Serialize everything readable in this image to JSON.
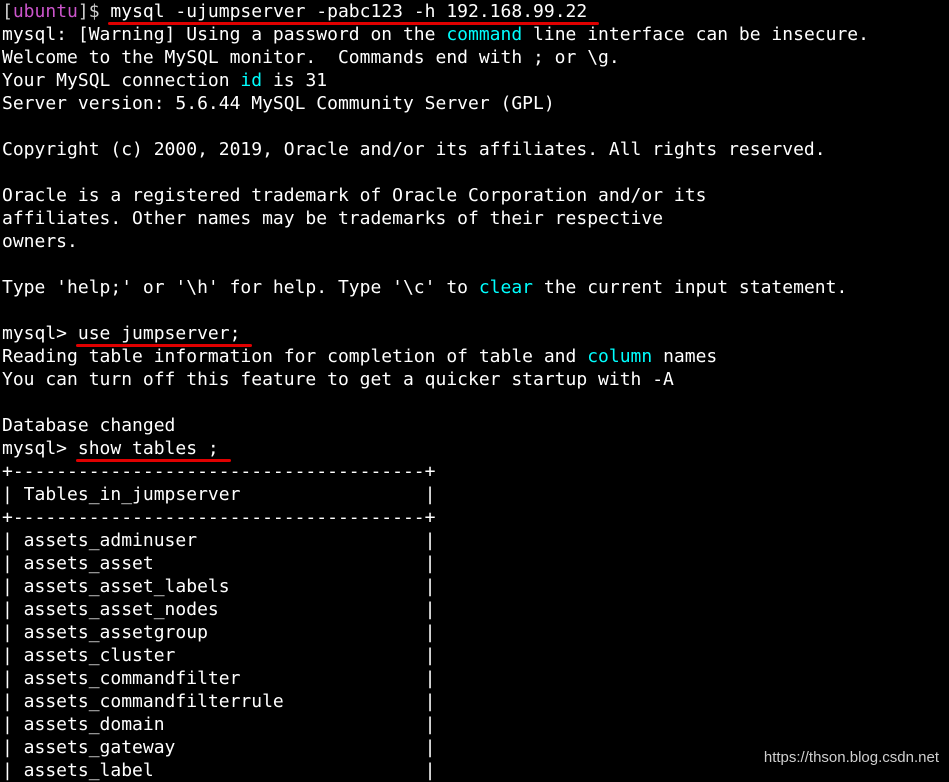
{
  "colors": {
    "background": "#000000",
    "text": "#ffffff",
    "keyword": "#00ffff",
    "prompt_user": "#cc55cc",
    "underline": "#e00000"
  },
  "terminal": {
    "shell_prompt": {
      "open": "[",
      "user": "ubuntu",
      "close": "]$ ",
      "command": "mysql -ujumpserver -pabc123 -h 192.168.99.22"
    },
    "warning": {
      "pre": "mysql: [Warning] Using a password on the ",
      "kw": "command",
      "post": " line interface can be insecure."
    },
    "welcome": "Welcome to the MySQL monitor.  Commands end with ; or \\g.",
    "connection": {
      "pre": "Your MySQL connection ",
      "kw": "id",
      "post": " is 31"
    },
    "server_version": "Server version: 5.6.44 MySQL Community Server (GPL)",
    "copyright": "Copyright (c) 2000, 2019, Oracle and/or its affiliates. All rights reserved.",
    "trademark_1": "Oracle is a registered trademark of Oracle Corporation and/or its",
    "trademark_2": "affiliates. Other names may be trademarks of their respective",
    "trademark_3": "owners.",
    "help": {
      "pre": "Type 'help;' or '\\h' for help. Type '\\c' to ",
      "kw": "clear",
      "post": " the current input statement."
    },
    "mysql_prompt": "mysql> ",
    "use_command": "use jumpserver;",
    "reading": {
      "pre": "Reading table information for completion of table and ",
      "kw": "column",
      "post": " names"
    },
    "quicker": "You can turn off this feature to get a quicker startup with -A",
    "db_changed": "Database changed",
    "show_command": "show tables ;",
    "table_border": "+--------------------------------------+",
    "table_header": "| Tables_in_jumpserver                 |",
    "rows": [
      "| assets_adminuser                     |",
      "| assets_asset                         |",
      "| assets_asset_labels                  |",
      "| assets_asset_nodes                   |",
      "| assets_assetgroup                    |",
      "| assets_cluster                       |",
      "| assets_commandfilter                 |",
      "| assets_commandfilterrule             |",
      "| assets_domain                        |",
      "| assets_gateway                       |",
      "| assets_label                         |"
    ]
  },
  "watermark": "https://thson.blog.csdn.net"
}
